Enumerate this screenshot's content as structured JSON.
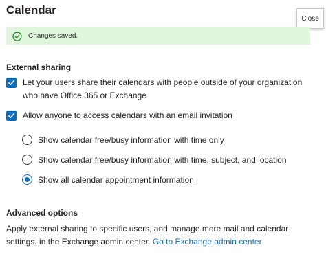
{
  "page": {
    "title": "Calendar"
  },
  "tooltip": {
    "close_label": "Close"
  },
  "banner": {
    "message": "Changes saved.",
    "icon": "checkmark-circle-icon",
    "background": "#dff6dd",
    "icon_color": "#107c10"
  },
  "external_sharing": {
    "heading": "External sharing",
    "options": [
      {
        "label": "Let your users share their calendars with people outside of your organization who have Office 365 or Exchange",
        "checked": true
      },
      {
        "label": "Allow anyone to access calendars with an email invitation",
        "checked": true
      }
    ],
    "detail_levels": [
      {
        "label": "Show calendar free/busy information with time only",
        "selected": false
      },
      {
        "label": "Show calendar free/busy information with time, subject, and location",
        "selected": false
      },
      {
        "label": "Show all calendar appointment information",
        "selected": true
      }
    ]
  },
  "advanced": {
    "heading": "Advanced options",
    "description": "Apply external sharing to specific users, and manage more mail and calendar settings, in the Exchange admin center.",
    "link_text": "Go to Exchange admin center"
  },
  "colors": {
    "accent": "#0f6cbd"
  }
}
